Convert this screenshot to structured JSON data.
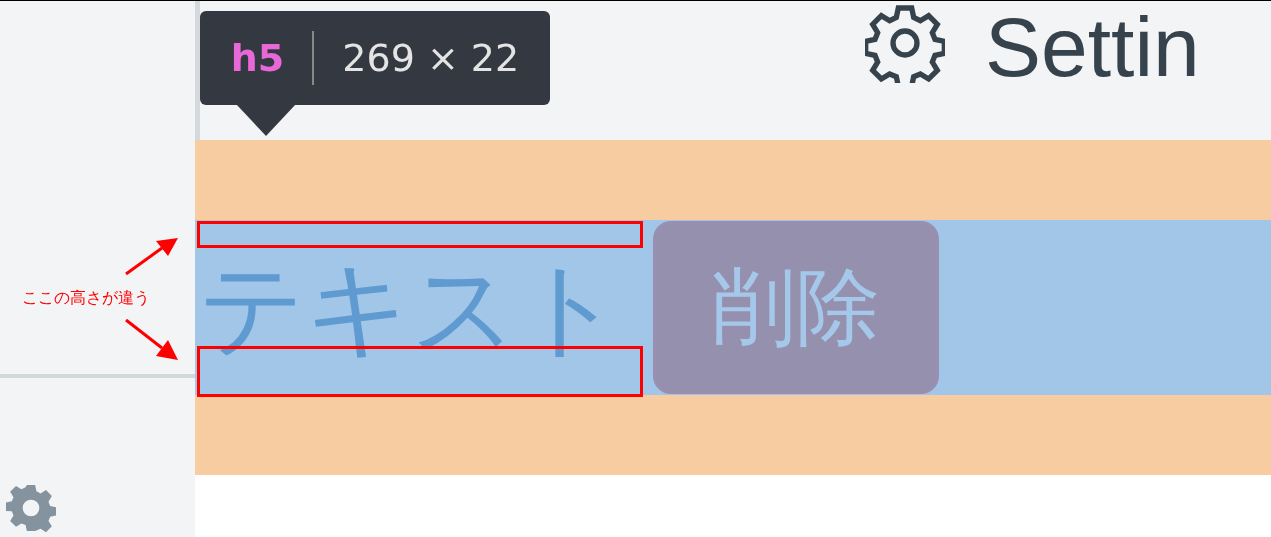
{
  "inspector_tooltip": {
    "tag": "h5",
    "size": "269 × 22"
  },
  "header": {
    "title": "Settin"
  },
  "item": {
    "text": "テキスト",
    "button": "削除"
  },
  "annotation": {
    "text": "ここの高さが違う"
  }
}
